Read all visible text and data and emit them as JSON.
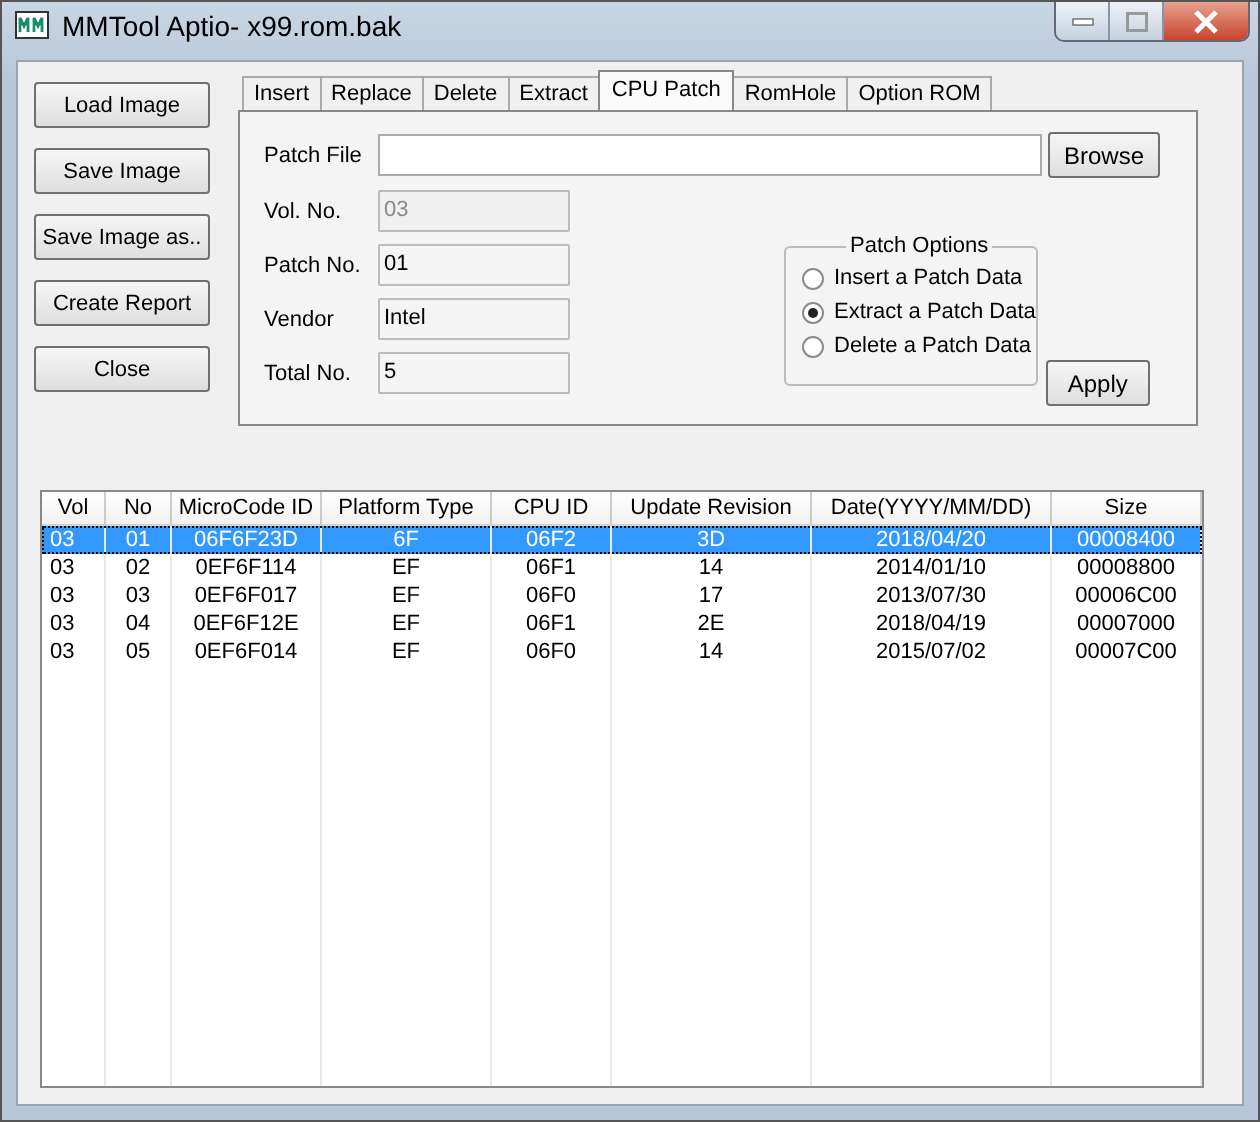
{
  "window": {
    "title": "MMTool Aptio- x99.rom.bak"
  },
  "side_buttons": [
    "Load Image",
    "Save Image",
    "Save Image as..",
    "Create Report",
    "Close"
  ],
  "tabs": [
    {
      "label": "Insert",
      "selected": false
    },
    {
      "label": "Replace",
      "selected": false
    },
    {
      "label": "Delete",
      "selected": false
    },
    {
      "label": "Extract",
      "selected": false
    },
    {
      "label": "CPU Patch",
      "selected": true
    },
    {
      "label": "RomHole",
      "selected": false
    },
    {
      "label": "Option ROM",
      "selected": false
    }
  ],
  "patch_file": {
    "label": "Patch File",
    "button": "Browse"
  },
  "fields": [
    {
      "label": "Vol. No.",
      "value": "03",
      "disabled": true
    },
    {
      "label": "Patch No.",
      "value": "01",
      "disabled": false
    },
    {
      "label": "Vendor",
      "value": "Intel",
      "disabled": false
    },
    {
      "label": "Total No.",
      "value": "5",
      "disabled": false
    }
  ],
  "patch_options": {
    "title": "Patch Options",
    "options": [
      {
        "label": "Insert a Patch Data",
        "selected": false
      },
      {
        "label": "Extract a Patch Data",
        "selected": true
      },
      {
        "label": "Delete a Patch Data",
        "selected": false
      }
    ]
  },
  "apply_button": "Apply",
  "table": {
    "columns": [
      "Vol",
      "No",
      "MicroCode ID",
      "Platform Type",
      "CPU ID",
      "Update Revision",
      "Date(YYYY/MM/DD)",
      "Size"
    ],
    "rows": [
      {
        "cells": [
          "03",
          "01",
          "06F6F23D",
          "6F",
          "06F2",
          "3D",
          "2018/04/20",
          "00008400"
        ],
        "selected": true
      },
      {
        "cells": [
          "03",
          "02",
          "0EF6F114",
          "EF",
          "06F1",
          "14",
          "2014/01/10",
          "00008800"
        ],
        "selected": false
      },
      {
        "cells": [
          "03",
          "03",
          "0EF6F017",
          "EF",
          "06F0",
          "17",
          "2013/07/30",
          "00006C00"
        ],
        "selected": false
      },
      {
        "cells": [
          "03",
          "04",
          "0EF6F12E",
          "EF",
          "06F1",
          "2E",
          "2018/04/19",
          "00007000"
        ],
        "selected": false
      },
      {
        "cells": [
          "03",
          "05",
          "0EF6F014",
          "EF",
          "06F0",
          "14",
          "2015/07/02",
          "00007C00"
        ],
        "selected": false
      }
    ]
  }
}
